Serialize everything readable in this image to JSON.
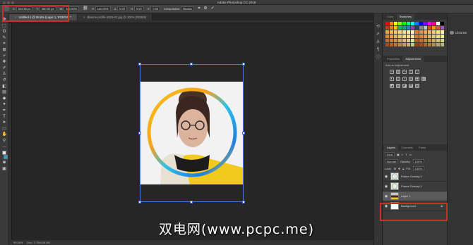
{
  "app": {
    "window_title": "Adobe Photoshop CC 2019"
  },
  "options_bar": {
    "fields": [
      {
        "label": "X:",
        "value": "526.50 px"
      },
      {
        "label": "Y:",
        "value": "380.00 px"
      },
      {
        "label": "W:",
        "value": "100.00%"
      },
      {
        "label": "H:",
        "value": "100.00%"
      },
      {
        "label": "∠",
        "value": "0.00"
      },
      {
        "label": "H:",
        "value": "0.00"
      },
      {
        "label": "V:",
        "value": "0.00"
      }
    ],
    "interpolation_label": "Interpolation:",
    "interpolation_value": "Bicubic"
  },
  "document_tabs": [
    {
      "label": "Untitled-1 @ 99.6% (Layer 1, RGB/16) *",
      "active": true
    },
    {
      "label": "dkaone-profile-2019-01.jpg @ 100% (RGB/8)",
      "active": false
    }
  ],
  "status_bar": {
    "zoom": "99.56%",
    "doc": "Doc: 3.75M/28.9M"
  },
  "panels": {
    "top_tabs": [
      "Color",
      "Swatches"
    ],
    "libraries_label": "Libraries",
    "properties_tabs": [
      "Properties",
      "Adjustments"
    ],
    "adjustments_hint": "Add an adjustment",
    "layers_tabs": [
      "Layers",
      "Channels",
      "Paths"
    ],
    "layers_controls": {
      "kind": "Kind",
      "mode": "Normal",
      "opacity_label": "Opacity:",
      "opacity": "100%",
      "lock_label": "Lock:",
      "fill_label": "Fill:",
      "fill": "100%"
    },
    "layers": [
      {
        "name": "Frame Overlay 2",
        "thumb": "frame",
        "selected": false,
        "locked": false
      },
      {
        "name": "Frame Overlay 1",
        "thumb": "frame",
        "selected": false,
        "locked": false
      },
      {
        "name": "Layer 1",
        "thumb": "photo",
        "selected": true,
        "locked": false
      },
      {
        "name": "Background",
        "thumb": "bg",
        "selected": false,
        "locked": true
      }
    ]
  },
  "swatch_colors": [
    "#ff0000",
    "#ff8000",
    "#ffff00",
    "#80ff00",
    "#00ff00",
    "#00ff80",
    "#00ffff",
    "#0080ff",
    "#0000ff",
    "#8000ff",
    "#ff00ff",
    "#ff0080",
    "#ffffff",
    "#000000",
    "#c0392b",
    "#e67e22",
    "#f1c40f",
    "#27ae60",
    "#16a085",
    "#2980b9",
    "#8e44ad",
    "#2c3e50",
    "#7f8c8d",
    "#bdc3c7",
    "#d35400",
    "#f39c12",
    "#e74c3c",
    "#9b59b6",
    "#e9a23b",
    "#f2b84b",
    "#f6c85f",
    "#f8d27a",
    "#f9dc94",
    "#fae5ad",
    "#fbeec6",
    "#e07b39",
    "#e48f4c",
    "#e9a35f",
    "#edb772",
    "#f1cb86",
    "#f5de99",
    "#f9f2ad",
    "#d98c3a",
    "#dea04d",
    "#e3b460",
    "#e8c873",
    "#eddc86",
    "#f2e09a",
    "#f7e4ad",
    "#cf7a30",
    "#d48e43",
    "#d9a256",
    "#deb669",
    "#e3ca7c",
    "#e8de8f",
    "#edf2a2",
    "#c46a28",
    "#c97e3b",
    "#ce924e",
    "#d3a661",
    "#d8ba74",
    "#ddce87",
    "#e2e29a",
    "#b85a20",
    "#bd6e33",
    "#c28246",
    "#c79659",
    "#ccaa6c",
    "#d1be7f",
    "#d6d292",
    "#aa4c18",
    "#af602b",
    "#b4743e",
    "#b98851",
    "#be9c64",
    "#c3b077",
    "#c8c48a",
    "#9c3e10",
    "#a15223",
    "#a66636",
    "#ab7a49",
    "#b08e5c",
    "#b5a26f",
    "#bab682"
  ],
  "watermark_text": "双电网(www.pcpc.me)"
}
